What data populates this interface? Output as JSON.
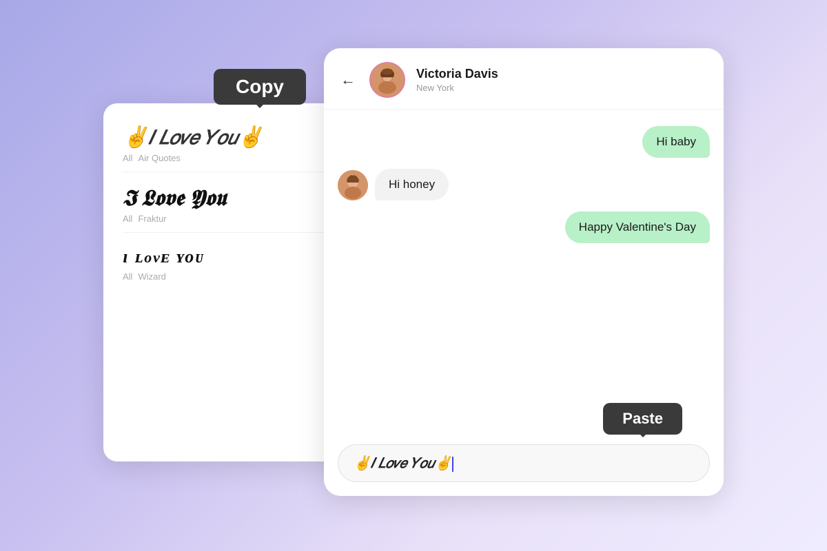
{
  "background": {
    "gradient_start": "#a8a8e8",
    "gradient_end": "#f0ecff"
  },
  "copy_tooltip": {
    "label": "Copy"
  },
  "font_panel": {
    "items": [
      {
        "text": "✌️𝐼 𝐿𝑜𝑣𝑒 𝑌𝑜𝑢✌️",
        "style": "air-quotes",
        "tags": [
          "All",
          "Air Quotes"
        ]
      },
      {
        "text": "𝕴 𝕷𝖔𝖛𝖊 𝖄𝖔𝖚",
        "style": "fraktur",
        "tags": [
          "All",
          "Fraktur"
        ]
      },
      {
        "text": "ɪ ʟᴏᴠᴇ ʏᴏᴜ",
        "style": "wizard",
        "tags": [
          "All",
          "Wizard"
        ]
      }
    ]
  },
  "chat": {
    "user": {
      "name": "Victoria Davis",
      "location": "New York"
    },
    "back_label": "←",
    "messages": [
      {
        "text": "Hi baby",
        "type": "sent"
      },
      {
        "text": "Hi honey",
        "type": "received"
      },
      {
        "text": "Happy Valentine's Day",
        "type": "sent"
      }
    ],
    "input_value": "✌️𝐼 𝐿𝑜𝑣𝑒 𝑌𝑜𝑢✌️",
    "paste_tooltip": "Paste"
  }
}
